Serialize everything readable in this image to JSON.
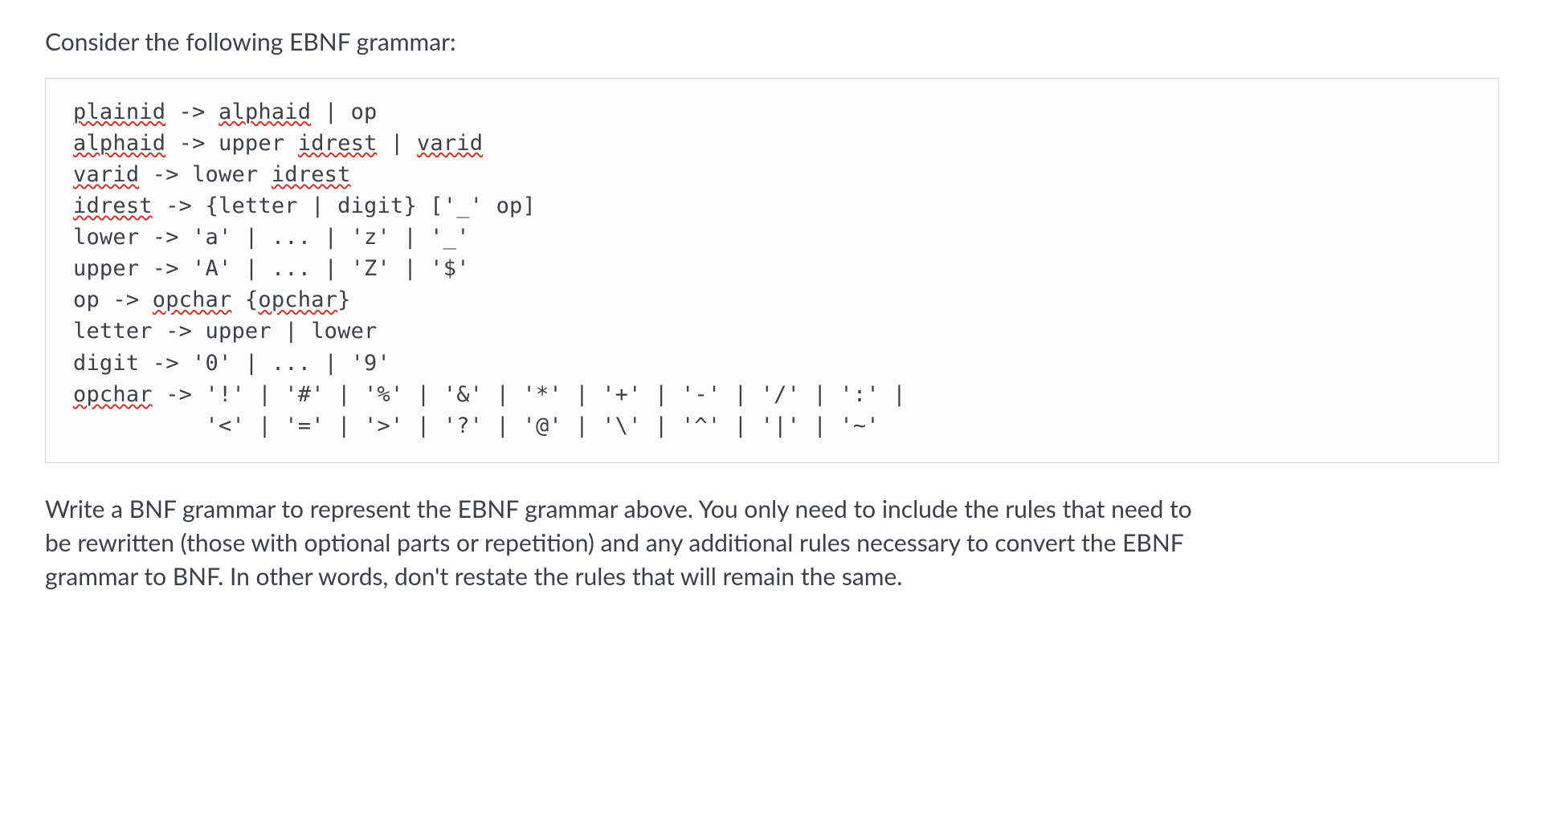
{
  "intro": "Consider the following EBNF grammar:",
  "grammar": {
    "rules": [
      {
        "tokens": [
          {
            "t": "plainid",
            "spell": true
          },
          {
            "t": " -> "
          },
          {
            "t": "alphaid",
            "spell": true
          },
          {
            "t": " | op"
          }
        ]
      },
      {
        "tokens": [
          {
            "t": "alphaid",
            "spell": true
          },
          {
            "t": " -> upper "
          },
          {
            "t": "idrest",
            "spell": true
          },
          {
            "t": " | "
          },
          {
            "t": "varid",
            "spell": true
          }
        ]
      },
      {
        "tokens": [
          {
            "t": "varid",
            "spell": true
          },
          {
            "t": " -> lower "
          },
          {
            "t": "idrest",
            "spell": true
          }
        ]
      },
      {
        "tokens": [
          {
            "t": "idrest",
            "spell": true
          },
          {
            "t": " -> {letter | digit} ['_' op]"
          }
        ]
      },
      {
        "tokens": [
          {
            "t": "lower -> 'a' | ... | 'z' | '_'"
          }
        ]
      },
      {
        "tokens": [
          {
            "t": "upper -> 'A' | ... | 'Z' | '$'"
          }
        ]
      },
      {
        "tokens": [
          {
            "t": "op -> "
          },
          {
            "t": "opchar",
            "spell": true
          },
          {
            "t": " {"
          },
          {
            "t": "opchar",
            "spell": true
          },
          {
            "t": "}"
          }
        ]
      },
      {
        "tokens": [
          {
            "t": "letter -> upper | lower"
          }
        ]
      },
      {
        "tokens": [
          {
            "t": "digit -> '0' | ... | '9'"
          }
        ]
      },
      {
        "tokens": [
          {
            "t": "opchar",
            "spell": true
          },
          {
            "t": " -> '!' | '#' | '%' | '&' | '*' | '+' | '-' | '/' | ':' |"
          }
        ]
      },
      {
        "tokens": [
          {
            "t": "          '<' | '=' | '>' | '?' | '@' | '\\' | '^' | '|' | '~'"
          }
        ]
      }
    ]
  },
  "task": "Write a BNF grammar to represent the EBNF grammar above. You only need to include the rules that need to be rewritten (those with optional parts or repetition) and any additional rules necessary to convert the EBNF grammar to BNF. In other words, don't restate the rules that will remain the same."
}
